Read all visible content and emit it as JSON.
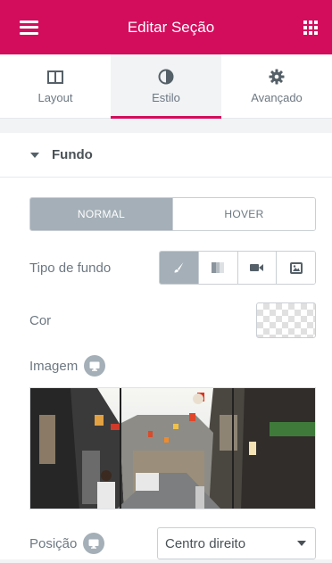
{
  "header": {
    "title": "Editar Seção",
    "menu_icon": "hamburger-icon",
    "grid_icon": "apps-grid-icon"
  },
  "tabs": [
    {
      "label": "Layout",
      "icon": "columns-icon",
      "active": false
    },
    {
      "label": "Estilo",
      "icon": "contrast-icon",
      "active": true
    },
    {
      "label": "Avançado",
      "icon": "gear-icon",
      "active": false
    }
  ],
  "section": {
    "title": "Fundo"
  },
  "state_toggle": {
    "normal": "NORMAL",
    "hover": "HOVER",
    "selected": "NORMAL"
  },
  "background_type": {
    "label": "Tipo de fundo",
    "options": [
      "brush-icon",
      "gradient-icon",
      "video-icon",
      "slideshow-icon"
    ],
    "selected": "brush-icon"
  },
  "color": {
    "label": "Cor"
  },
  "image": {
    "label": "Imagem",
    "responsive_icon": "monitor-icon"
  },
  "position": {
    "label": "Posição",
    "value": "Centro direito",
    "responsive_icon": "monitor-icon"
  },
  "colors": {
    "accent": "#d30c5c",
    "active_button": "#a4afb7",
    "text": "#6d7882"
  }
}
